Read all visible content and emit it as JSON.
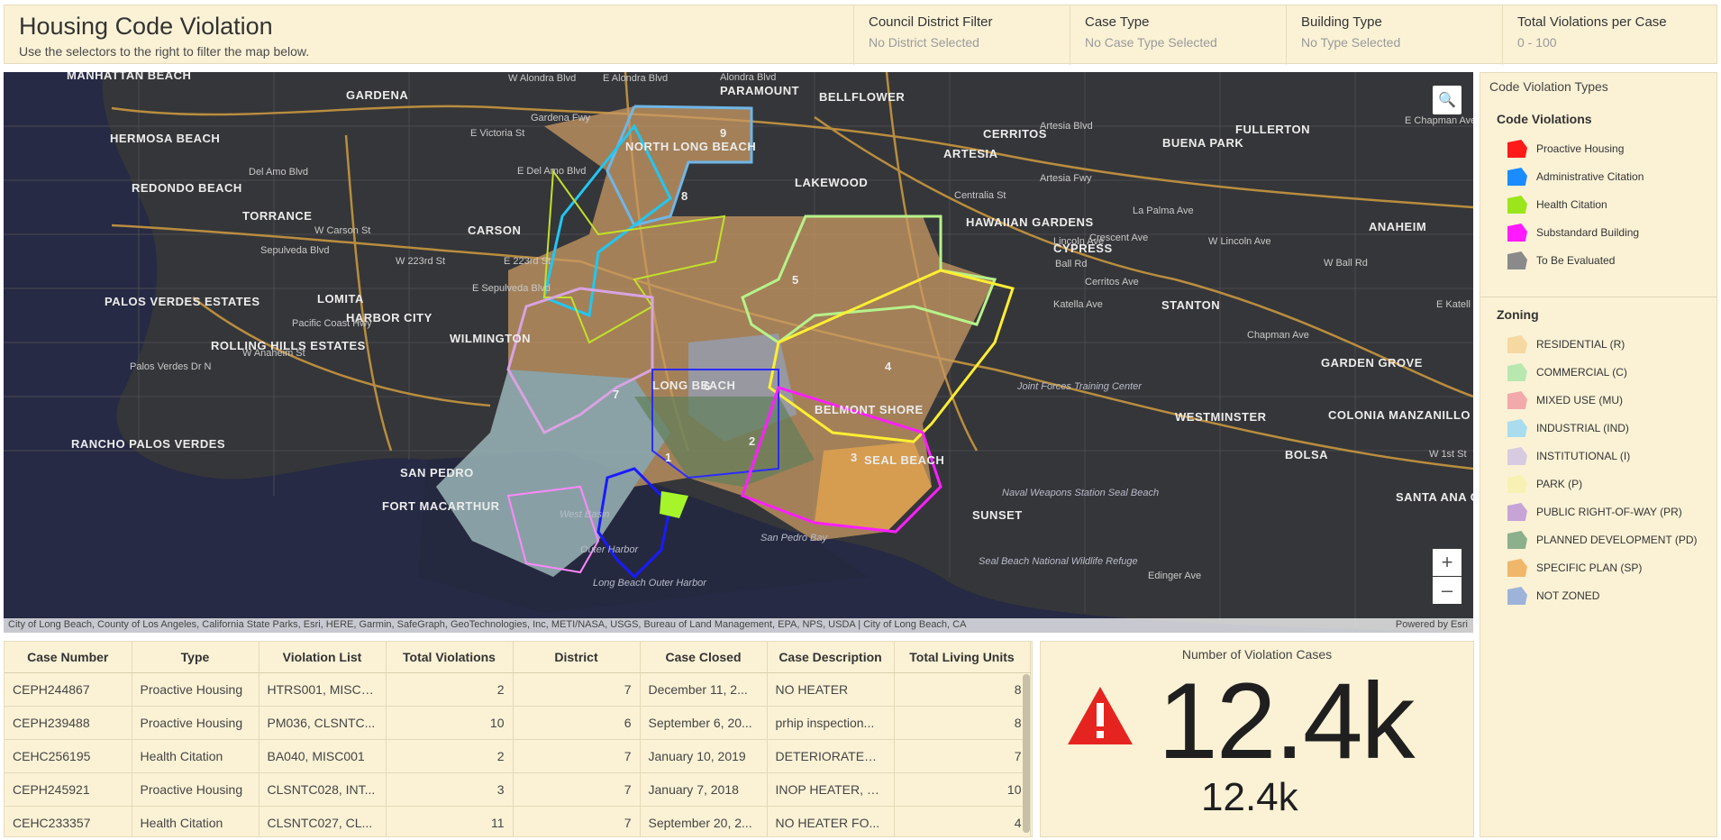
{
  "header": {
    "title": "Housing Code Violation",
    "subtitle": "Use the selectors to the right to filter the map below.",
    "filters": [
      {
        "label": "Council District Filter",
        "value": "No District Selected"
      },
      {
        "label": "Case Type",
        "value": "No Case Type Selected"
      },
      {
        "label": "Building Type",
        "value": "No Type Selected"
      },
      {
        "label": "Total Violations per Case",
        "value": "0 - 100"
      }
    ]
  },
  "map": {
    "search_icon": "search-icon",
    "zoom_in": "+",
    "zoom_out": "–",
    "attribution": "City of Long Beach, County of Los Angeles, California State Parks, Esri, HERE, Garmin, SafeGraph, GeoTechnologies, Inc, METI/NASA, USGS, Bureau of Land Management, EPA, NPS, USDA | City of Long Beach, CA",
    "powered_by": "Powered by Esri",
    "cities": [
      "MANHATTAN BEACH",
      "GARDENA",
      "PARAMOUNT",
      "BELLFLOWER",
      "HERMOSA BEACH",
      "CERRITOS",
      "FULLERTON",
      "BUENA PARK",
      "ARTESIA",
      "REDONDO BEACH",
      "LAKEWOOD",
      "TORRANCE",
      "CARSON",
      "HAWAIIAN GARDENS",
      "CYPRESS",
      "ANAHEIM",
      "NORTH LONG BEACH",
      "PALOS VERDES ESTATES",
      "LOMITA",
      "HARBOR CITY",
      "STANTON",
      "ROLLING HILLS ESTATES",
      "WILMINGTON",
      "LONG BEACH",
      "BELMONT SHORE",
      "GARDEN GROVE",
      "WESTMINSTER",
      "COLONIA MANZANILLO",
      "RANCHO PALOS VERDES",
      "SAN PEDRO",
      "SEAL BEACH",
      "BOLSA",
      "FORT MACARTHUR",
      "SUNSET",
      "SANTA ANA GARDENS"
    ],
    "streets": [
      "W Alondra Blvd",
      "E Alondra Blvd",
      "Alondra Blvd",
      "Gardena Fwy",
      "E Victoria St",
      "Del Amo Blvd",
      "E Del Amo Blvd",
      "W Carson St",
      "Sepulveda Blvd",
      "W 223rd St",
      "E 223rd St",
      "E Sepulveda Blvd",
      "Pacific Coast Hwy",
      "W Anaheim St",
      "Palos Verdes Dr N",
      "Artesia Blvd",
      "Artesia Fwy",
      "E Chapman Ave",
      "La Palma Ave",
      "Crescent Ave",
      "Centralia St",
      "Lincoln Ave",
      "W Lincoln Ave",
      "Ball Rd",
      "W Ball Rd",
      "Cerritos Ave",
      "Katella Ave",
      "E Katell",
      "Chapman Ave",
      "Edinger Ave",
      "W 1st St"
    ],
    "water": [
      "Long Beach Outer Harbor",
      "San Pedro Bay",
      "West Basin",
      "Outer Harbor",
      "Naval Weapons Station Seal Beach",
      "Seal Beach National Wildlife Refuge",
      "Joint Forces Training Center"
    ],
    "districts": [
      "9",
      "8",
      "5",
      "4",
      "7",
      "6",
      "2",
      "3",
      "1"
    ]
  },
  "legend": {
    "title": "Code Violation Types",
    "violations_heading": "Code Violations",
    "violations": [
      {
        "label": "Proactive Housing",
        "color": "#ff1a1a"
      },
      {
        "label": "Administrative Citation",
        "color": "#1a8cff"
      },
      {
        "label": "Health Citation",
        "color": "#9be61a"
      },
      {
        "label": "Substandard Building",
        "color": "#ff1aff"
      },
      {
        "label": "To Be Evaluated",
        "color": "#8a8a8a"
      }
    ],
    "zoning_heading": "Zoning",
    "zoning": [
      {
        "label": "RESIDENTIAL (R)",
        "color": "#f5d9a1"
      },
      {
        "label": "COMMERCIAL (C)",
        "color": "#b8e8b0"
      },
      {
        "label": "MIXED USE (MU)",
        "color": "#f2a9a9"
      },
      {
        "label": "INDUSTRIAL (IND)",
        "color": "#a9dcee"
      },
      {
        "label": "INSTITUTIONAL (I)",
        "color": "#d6cbe0"
      },
      {
        "label": "PARK (P)",
        "color": "#f7f2b3"
      },
      {
        "label": "PUBLIC RIGHT-OF-WAY (PR)",
        "color": "#c7a4d6"
      },
      {
        "label": "PLANNED DEVELOPMENT (PD)",
        "color": "#8bb08b"
      },
      {
        "label": "SPECIFIC PLAN (SP)",
        "color": "#f0b66a"
      },
      {
        "label": "NOT ZONED",
        "color": "#9db3d9"
      }
    ]
  },
  "table": {
    "columns": [
      "Case Number",
      "Type",
      "Violation List",
      "Total Violations",
      "District",
      "Case Closed",
      "Case Description",
      "Total Living Units"
    ],
    "rows": [
      [
        "CEPH244867",
        "Proactive Housing",
        "HTRS001, MISC0...",
        "2",
        "7",
        "December 11, 2...",
        "NO HEATER",
        "8"
      ],
      [
        "CEPH239488",
        "Proactive Housing",
        "PM036, CLSNTC...",
        "10",
        "6",
        "September 6, 20...",
        "prhip inspection...",
        "8"
      ],
      [
        "CEHC256195",
        "Health Citation",
        "BA040, MISC001",
        "2",
        "7",
        "January 10, 2019",
        "DETERIORATED ...",
        "7"
      ],
      [
        "CEPH245921",
        "Proactive Housing",
        "CLSNTC028, INT...",
        "3",
        "7",
        "January 7, 2018",
        "INOP HEATER, S...",
        "10"
      ],
      [
        "CEHC233357",
        "Health Citation",
        "CLSNTC027, CL...",
        "11",
        "7",
        "September 20, 2...",
        "NO HEATER FO...",
        "4"
      ]
    ]
  },
  "indicator": {
    "title": "Number of Violation Cases",
    "value": "12.4k",
    "secondary": "12.4k",
    "icon": "warning-icon",
    "icon_color": "#e52420"
  }
}
